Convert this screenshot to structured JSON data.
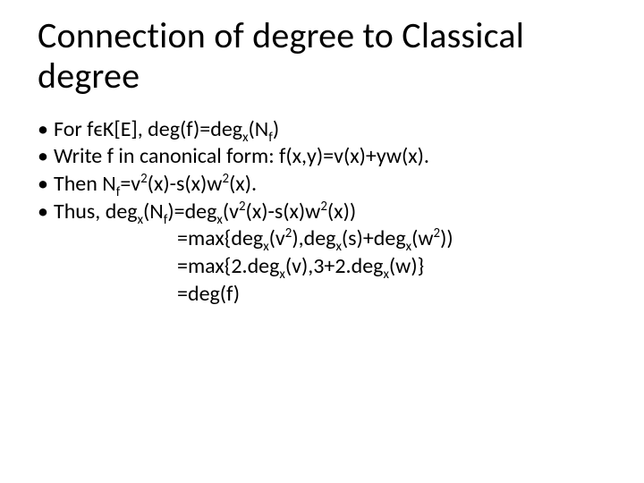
{
  "title": "Connection of degree to Classical degree",
  "bullets": {
    "b1_pre": "For f",
    "b1_eps": "ϵ",
    "b1_post1": "K[E], deg(f)=deg",
    "b1_sub1": "x",
    "b1_post2": "(N",
    "b1_sub2": "f",
    "b1_post3": ")",
    "b2": "Write f in canonical form: f(x,y)=v(x)+yw(x).",
    "b3_pre": "Then N",
    "b3_sub1": "f",
    "b3_mid1": "=v",
    "b3_sup1": "2",
    "b3_mid2": "(x)-s(x)w",
    "b3_sup2": "2",
    "b3_post": "(x).",
    "b4_pre": "Thus, deg",
    "b4_sub1": "x",
    "b4_mid1": "(N",
    "b4_sub2": "f",
    "b4_mid2": ")=deg",
    "b4_sub3": "x",
    "b4_mid3": "(v",
    "b4_sup1": "2",
    "b4_mid4": "(x)-s(x)w",
    "b4_sup2": "2",
    "b4_post": "(x))",
    "c1_pre": "=max{deg",
    "c1_sub1": "x",
    "c1_mid1": "(v",
    "c1_sup1": "2",
    "c1_mid2": "),deg",
    "c1_sub2": "x",
    "c1_mid3": "(s)+deg",
    "c1_sub3": "x",
    "c1_mid4": "(w",
    "c1_sup2": "2",
    "c1_post": "))",
    "c2_pre": "=max{2.deg",
    "c2_sub1": "x",
    "c2_mid1": "(v),3+2.deg",
    "c2_sub2": "x",
    "c2_post": "(w)}",
    "c3": "=deg(f)"
  }
}
